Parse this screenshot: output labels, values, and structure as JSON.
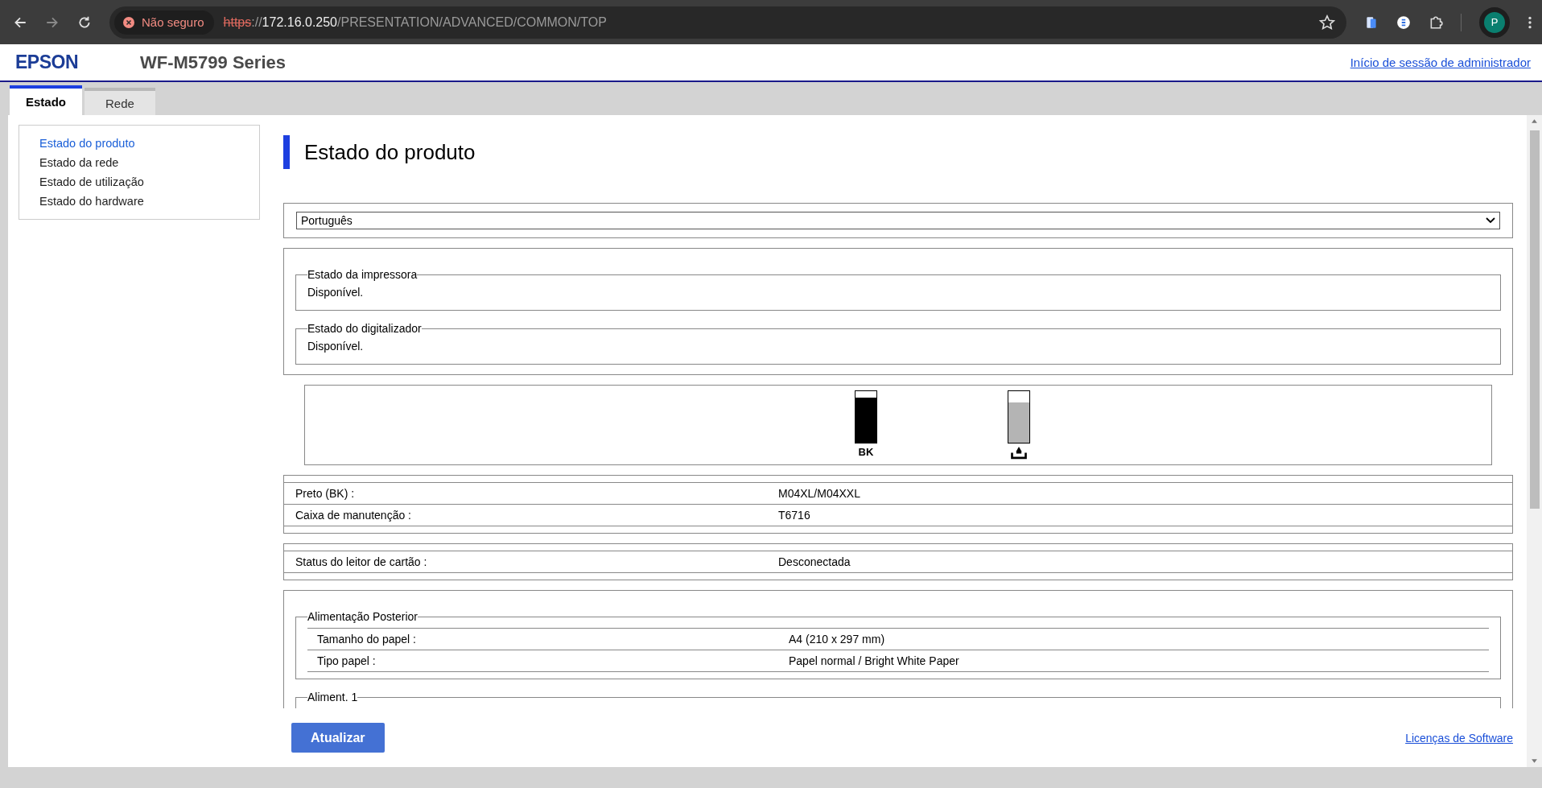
{
  "browser": {
    "security_label": "Não seguro",
    "url": {
      "scheme": "https",
      "separator": "://",
      "host": "172.16.0.250",
      "path": "/PRESENTATION/ADVANCED/COMMON/TOP"
    },
    "profile_initial": "P"
  },
  "header": {
    "logo": "EPSON",
    "model": "WF-M5799 Series",
    "admin_link": "Início de sessão de administrador"
  },
  "tabs": [
    {
      "label": "Estado",
      "selected": true
    },
    {
      "label": "Rede",
      "selected": false
    }
  ],
  "sidebar": {
    "items": [
      {
        "label": "Estado do produto",
        "selected": true
      },
      {
        "label": "Estado da rede",
        "selected": false
      },
      {
        "label": "Estado de utilização",
        "selected": false
      },
      {
        "label": "Estado do hardware",
        "selected": false
      }
    ]
  },
  "page_title": "Estado do produto",
  "language_select": {
    "value": "Português"
  },
  "status_groups": [
    {
      "legend": "Estado da impressora",
      "text": "Disponível."
    },
    {
      "legend": "Estado do digitalizador",
      "text": "Disponível."
    }
  ],
  "consumables": [
    {
      "kind": "ink",
      "label": "BK",
      "level": 0.88
    },
    {
      "kind": "maintenance",
      "level": 0.78
    }
  ],
  "consumable_table": [
    {
      "label": "Preto (BK) :",
      "value": "M04XL/M04XXL"
    },
    {
      "label": "Caixa de manutenção :",
      "value": "T6716"
    }
  ],
  "card_reader_table": [
    {
      "label": "Status do leitor de cartão :",
      "value": "Desconectada"
    }
  ],
  "paper_sources": [
    {
      "legend": "Alimentação Posterior",
      "rows": [
        {
          "label": "Tamanho do papel :",
          "value": "A4 (210 x 297 mm)"
        },
        {
          "label": "Tipo papel :",
          "value": "Papel normal / Bright White Paper"
        }
      ]
    },
    {
      "legend": "Aliment. 1"
    }
  ],
  "footer": {
    "button": "Atualizar",
    "license_link": "Licenças de Software"
  }
}
